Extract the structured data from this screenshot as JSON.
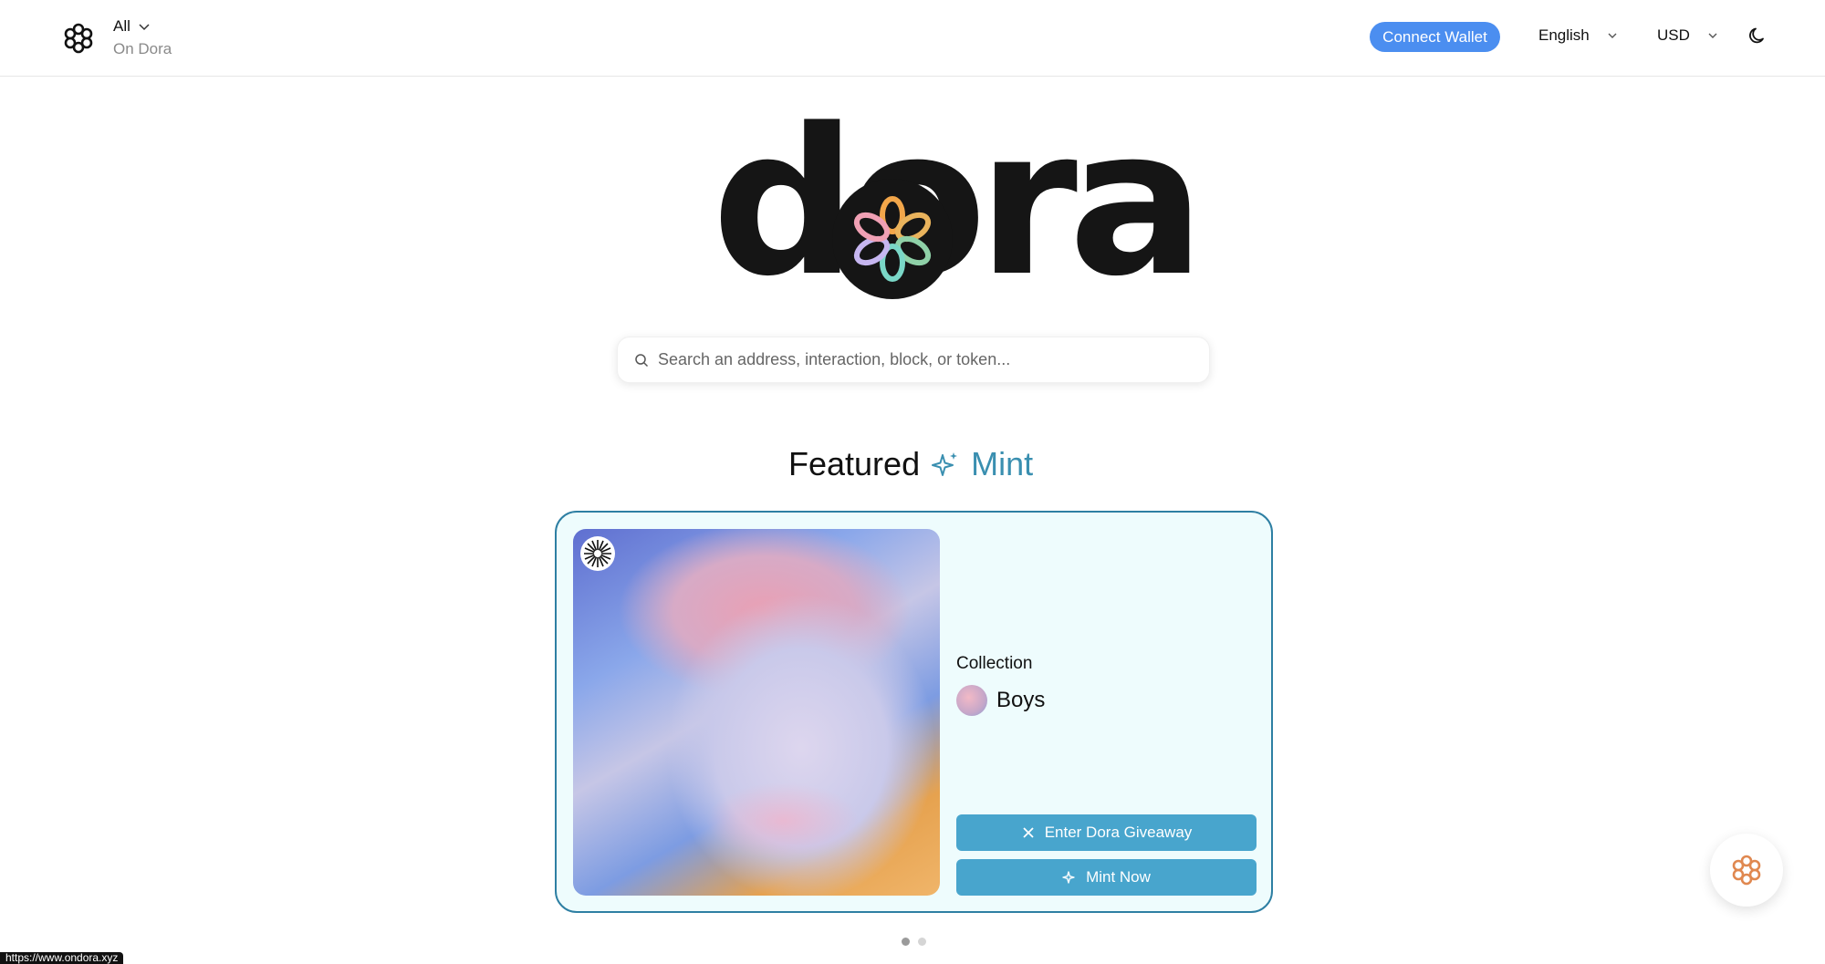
{
  "header": {
    "network_label": "All",
    "network_sub": "On Dora",
    "connect_label": "Connect Wallet",
    "language": "English",
    "currency": "USD"
  },
  "hero": {
    "logo_text": "dora"
  },
  "search": {
    "placeholder": "Search an address, interaction, block, or token..."
  },
  "featured": {
    "title": "Featured",
    "accent": "Mint"
  },
  "card": {
    "collection_label": "Collection",
    "collection_name": "Boys",
    "giveaway_label": "Enter Dora Giveaway",
    "mint_label": "Mint Now"
  },
  "carousel": {
    "total": 2,
    "active": 1
  },
  "status_url": "https://www.ondora.xyz",
  "colors": {
    "accent_blue": "#4b8ef0",
    "mint_teal": "#3a8fb0",
    "button_teal": "#48a5cd",
    "card_bg": "#eefcfd",
    "card_border": "#2e7fa3"
  },
  "icons": [
    "dora-logo-icon",
    "chevron-down-icon",
    "moon-icon",
    "search-icon",
    "sparkle-icon",
    "x-icon",
    "dora-float-icon"
  ]
}
